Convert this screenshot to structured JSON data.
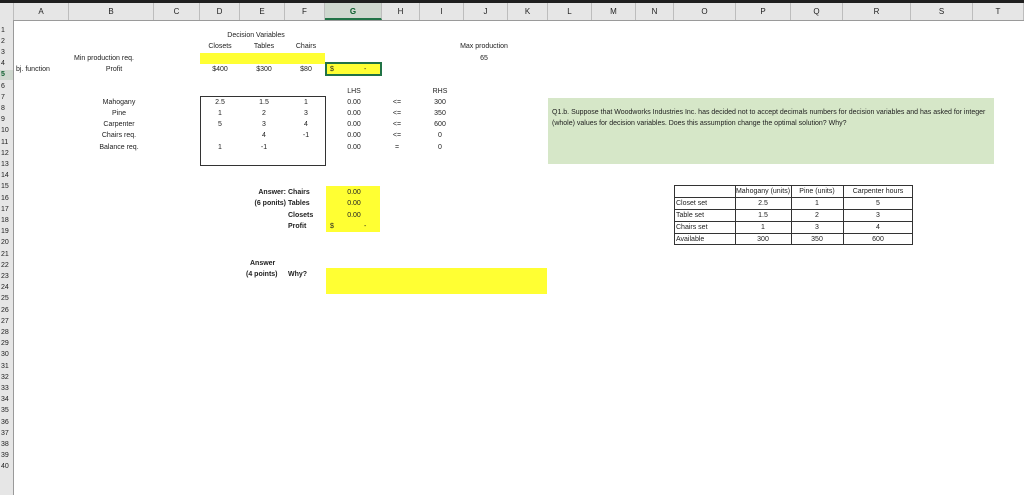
{
  "columns": [
    "A",
    "B",
    "C",
    "D",
    "E",
    "F",
    "G",
    "H",
    "I",
    "J",
    "K",
    "L",
    "M",
    "N",
    "O",
    "P",
    "Q",
    "R",
    "S",
    "T"
  ],
  "rows": [
    "1",
    "2",
    "3",
    "4",
    "5",
    "6",
    "7",
    "8",
    "9",
    "10",
    "11",
    "12",
    "13",
    "14",
    "15",
    "16",
    "17",
    "18",
    "19",
    "20",
    "21",
    "22",
    "23",
    "24",
    "25",
    "26",
    "27",
    "28",
    "29",
    "30",
    "31",
    "32",
    "33",
    "34",
    "35",
    "36",
    "37",
    "38",
    "39",
    "40"
  ],
  "sheet": {
    "a5": "bj. function",
    "decision_variables": "Decision Variables",
    "closets": "Closets",
    "tables": "Tables",
    "chairs": "Chairs",
    "max_production": "Max production",
    "max_production_value": "65",
    "min_production": "Min production req.",
    "profit": "Profit",
    "price_closets": "$400",
    "price_tables": "$300",
    "price_chairs": "$80",
    "g5_dollar": "$",
    "g5_dash": "-",
    "lhs": "LHS",
    "rhs": "RHS",
    "constraints": [
      {
        "name": "Mahogany",
        "d": "2.5",
        "e": "1.5",
        "f": "1",
        "lhs": "0.00",
        "sign": "<=",
        "rhs": "300"
      },
      {
        "name": "Pine",
        "d": "1",
        "e": "2",
        "f": "3",
        "lhs": "0.00",
        "sign": "<=",
        "rhs": "350"
      },
      {
        "name": "Carpenter",
        "d": "5",
        "e": "3",
        "f": "4",
        "lhs": "0.00",
        "sign": "<=",
        "rhs": "600"
      },
      {
        "name": "Chairs req.",
        "d": "",
        "e": "4",
        "f": "-1",
        "lhs": "0.00",
        "sign": "<=",
        "rhs": "0"
      },
      {
        "name": "Balance req.",
        "d": "1",
        "e": "-1",
        "f": "",
        "lhs": "0.00",
        "sign": "=",
        "rhs": "0"
      }
    ],
    "answer_label": "Answer:",
    "points6": "(6 ponits)",
    "ans_chairs": "Chairs",
    "ans_tables": "Tables",
    "ans_closets": "Closets",
    "ans_profit": "Profit",
    "ans_val1": "0.00",
    "ans_val2": "0.00",
    "ans_val3": "0.00",
    "ans_profit_dollar": "$",
    "ans_profit_dash": "-",
    "answer2": "Answer",
    "points4": "(4 points)",
    "why": "Why?",
    "question": "Q1.b. Suppose that Woodworks Industries Inc. has decided not to accept decimals numbers for decision variables and has asked for integer (whole) values for decision variables. Does this assumption change the optimal solution? Why?",
    "table2": {
      "headers": [
        "Mahogany (units)",
        "Pine (units)",
        "Carpenter hours"
      ],
      "rows": [
        {
          "label": "Closet set",
          "v": [
            "2.5",
            "1",
            "5"
          ]
        },
        {
          "label": "Table set",
          "v": [
            "1.5",
            "2",
            "3"
          ]
        },
        {
          "label": "Chairs set",
          "v": [
            "1",
            "3",
            "4"
          ]
        },
        {
          "label": "Available",
          "v": [
            "300",
            "350",
            "600"
          ]
        }
      ]
    }
  },
  "colors": {
    "highlight": "#ffff33",
    "question_bg": "#d6e7c8",
    "selection": "#217346"
  }
}
